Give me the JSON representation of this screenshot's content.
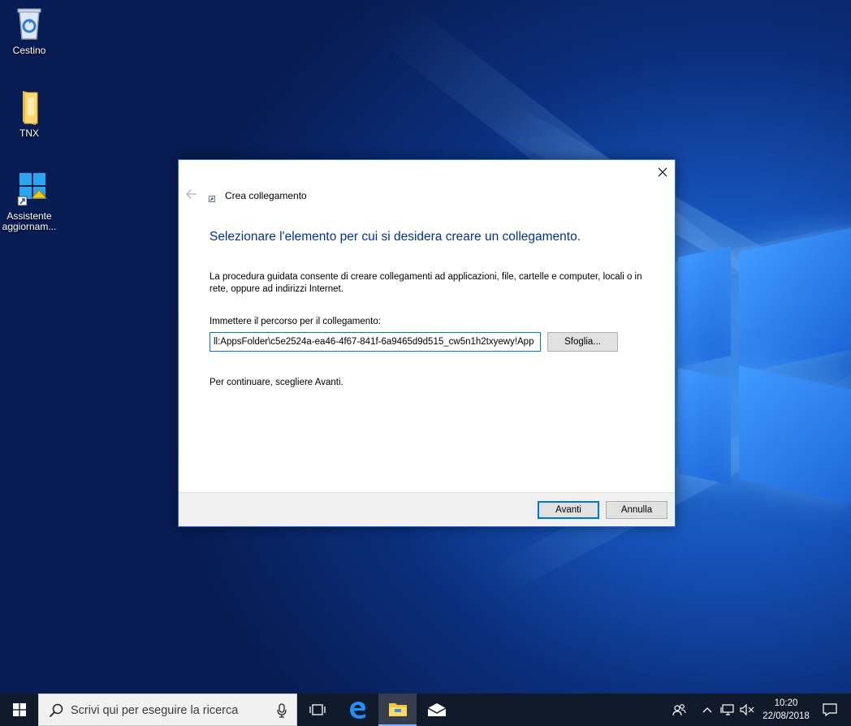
{
  "desktop": {
    "icons": [
      {
        "label": "Cestino",
        "icon": "recycle-bin-icon"
      },
      {
        "label": "TNX",
        "icon": "folder-icon"
      },
      {
        "label": "Assistente aggiornam...",
        "icon": "windows-update-assistant-icon"
      }
    ]
  },
  "dialog": {
    "title": "Crea collegamento",
    "heading": "Selezionare l'elemento per cui si desidera creare un collegamento.",
    "description": "La procedura guidata consente di creare collegamenti ad applicazioni, file, cartelle e computer, locali o in rete, oppure ad indirizzi Internet.",
    "path_label": "Immettere il percorso per il collegamento:",
    "path_value": "ll:AppsFolder\\c5e2524a-ea46-4f67-841f-6a9465d9d515_cw5n1h2txyewy!App",
    "browse_label": "Sfoglia...",
    "continue_hint": "Per continuare, scegliere Avanti.",
    "next_label": "Avanti",
    "cancel_label": "Annulla"
  },
  "taskbar": {
    "search_placeholder": "Scrivi qui per eseguire la ricerca",
    "pinned": [
      "task-view-icon",
      "edge-icon",
      "file-explorer-icon",
      "mail-icon"
    ],
    "clock_time": "10:20",
    "clock_date": "22/08/2018"
  },
  "colors": {
    "accent": "#0078d7",
    "heading_blue": "#003399",
    "taskbar_bg": "#101a2b"
  }
}
